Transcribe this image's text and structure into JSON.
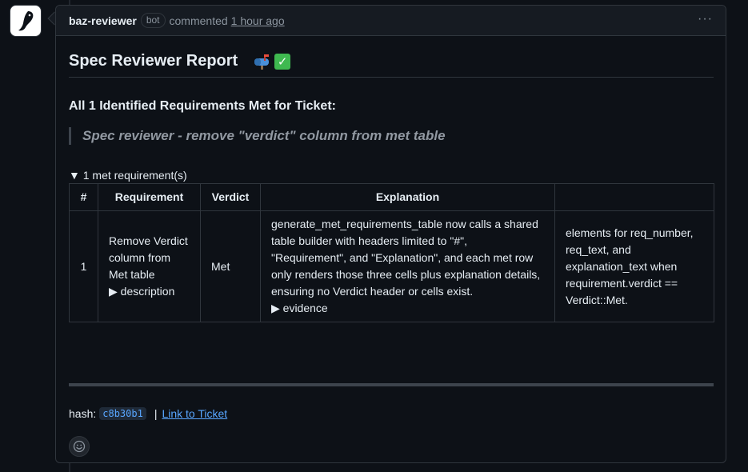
{
  "comment": {
    "author": "baz-reviewer",
    "badge": "bot",
    "action": "commented",
    "time": "1 hour ago",
    "menu": "···"
  },
  "report": {
    "title": "Spec Reviewer Report",
    "heading": "All 1 Identified Requirements Met for Ticket:",
    "ticket_title": "Spec reviewer - remove \"verdict\" column from met table",
    "summary": "▼ 1 met requirement(s)"
  },
  "table": {
    "headers": [
      "#",
      "Requirement",
      "Verdict",
      "Explanation",
      ""
    ],
    "rows": [
      {
        "number": "1",
        "requirement": "Remove Verdict column from Met table",
        "requirement_details": "▶ description",
        "verdict": "Met",
        "explanation": "generate_met_requirements_table now calls a shared table builder with headers limited to \"#\", \"Requirement\", and \"Explanation\", and each met row only renders those three cells plus explanation details, ensuring no Verdict header or cells exist.",
        "explanation_details": "▶ evidence",
        "extra": "elements for req_number, req_text, and explanation_text when requirement.verdict == Verdict::Met."
      }
    ]
  },
  "footer": {
    "hash_label": "hash:",
    "hash": "c8b30b1",
    "separator": "|",
    "link": "Link to Ticket"
  },
  "colors": {
    "background": "#0d1117",
    "border": "#30363d",
    "link": "#58a6ff",
    "check": "#3fb950"
  },
  "icons": [
    "baz-logo-icon",
    "mailbox-icon",
    "check-mark-icon",
    "smiley-icon"
  ]
}
